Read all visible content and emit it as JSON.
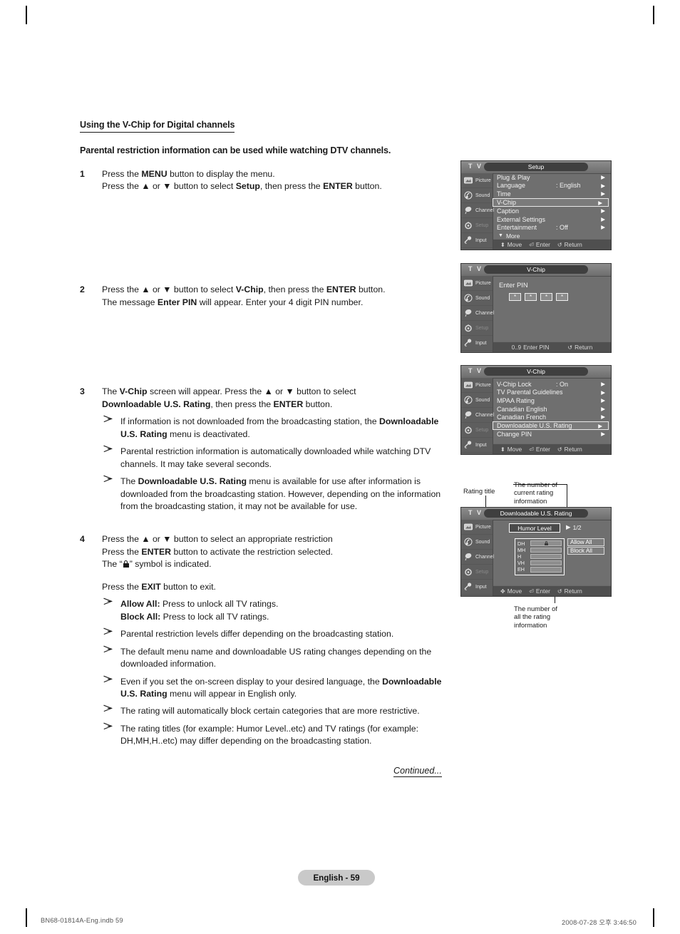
{
  "document": {
    "section_title": "Using the V-Chip for Digital channels",
    "lead": "Parental restriction information can be used while watching DTV channels.",
    "continued": "Continued...",
    "page_badge": "English - 59",
    "footer_left": "BN68-01814A-Eng.indb   59",
    "footer_right": "2008-07-28   오후 3:46:50"
  },
  "steps": {
    "s1": {
      "num": "1",
      "line1_a": "Press the ",
      "line1_b": "MENU",
      "line1_c": " button to display the menu.",
      "line2_a": "Press the ▲ or ▼ button to select ",
      "line2_b": "Setup",
      "line2_c": ", then press the ",
      "line2_d": "ENTER",
      "line2_e": " button."
    },
    "s2": {
      "num": "2",
      "line1_a": "Press the ▲ or ▼ button to select ",
      "line1_b": "V-Chip",
      "line1_c": ", then press the ",
      "line1_d": "ENTER",
      "line1_e": " button.",
      "line2_a": "The message ",
      "line2_b": "Enter PIN",
      "line2_c": " will appear. Enter your 4 digit PIN number."
    },
    "s3": {
      "num": "3",
      "line1_a": "The ",
      "line1_b": "V-Chip",
      "line1_c": " screen will appear. Press the ▲ or ▼ button to select",
      "line2_a": "Downloadable U.S. Rating",
      "line2_b": ", then press the ",
      "line2_c": "ENTER",
      "line2_d": " button.",
      "bullets": [
        {
          "a": "If information is not downloaded from the broadcasting station, the ",
          "b": "Downloadable U.S. Rating",
          "c": " menu is deactivated."
        },
        {
          "a": "Parental restriction information is automatically downloaded while watching DTV channels. It may take several seconds.",
          "b": "",
          "c": ""
        },
        {
          "a": "The ",
          "b": "Downloadable U.S. Rating",
          "c": " menu is available for use after information is downloaded from the broadcasting station. However, depending on the information from the broadcasting station, it may not be available for use."
        }
      ]
    },
    "s4": {
      "num": "4",
      "line1": "Press the ▲ or ▼ button to select an appropriate restriction",
      "line2_a": "Press the ",
      "line2_b": "ENTER",
      "line2_c": " button to activate the restriction selected.",
      "line3_a": "The “",
      "line3_b": "” symbol is indicated.",
      "exit_a": "Press the ",
      "exit_b": "EXIT",
      "exit_c": " button to exit.",
      "bullets": [
        {
          "a": "Allow All:",
          "b": " Press to unlock all TV ratings.",
          "c": "Block All:",
          "d": " Press to lock all TV ratings."
        },
        {
          "a": "Parental restriction levels differ depending on the broadcasting station."
        },
        {
          "a": "The default menu name and downloadable US rating changes depending on the downloaded information."
        },
        {
          "a": "Even if you set the on-screen display to your desired language, the ",
          "b": "Downloadable U.S. Rating",
          "c": " menu will appear in English only."
        },
        {
          "a": "The rating will automatically block certain categories that are more restrictive."
        },
        {
          "a": "The rating titles (for example: Humor Level..etc) and TV ratings (for example: DH,MH,H..etc) may differ depending on the broadcasting station."
        }
      ]
    }
  },
  "osd_common": {
    "tv_label": "T V",
    "sidebar": [
      {
        "label": "Picture",
        "icon": "picture-icon",
        "dim": false
      },
      {
        "label": "Sound",
        "icon": "sound-icon",
        "dim": false
      },
      {
        "label": "Channel",
        "icon": "channel-icon",
        "dim": false
      },
      {
        "label": "Setup",
        "icon": "setup-icon",
        "dim": true
      },
      {
        "label": "Input",
        "icon": "input-icon",
        "dim": false
      }
    ],
    "footer": {
      "move": "Move",
      "enter": "Enter",
      "return": "Return",
      "enter_pin": "Enter PIN",
      "pin_range": "0..9"
    },
    "arrow": "▶"
  },
  "osd1": {
    "title": "Setup",
    "rows": [
      {
        "name": "Plug & Play",
        "value": "",
        "selected": false
      },
      {
        "name": "Language",
        "value": ": English",
        "selected": false
      },
      {
        "name": "Time",
        "value": "",
        "selected": false
      },
      {
        "name": "V-Chip",
        "value": "",
        "selected": true
      },
      {
        "name": "Caption",
        "value": "",
        "selected": false
      },
      {
        "name": "External Settings",
        "value": "",
        "selected": false
      },
      {
        "name": "Entertainment",
        "value": ": Off",
        "selected": false
      }
    ],
    "more": "More"
  },
  "osd2": {
    "title": "V-Chip",
    "prompt": "Enter PIN",
    "pin_digits": [
      "*",
      "*",
      "*",
      "*"
    ]
  },
  "osd3": {
    "title": "V-Chip",
    "rows": [
      {
        "name": "V-Chip Lock",
        "value": ": On",
        "selected": false
      },
      {
        "name": "TV Parental Guidelines",
        "value": "",
        "selected": false
      },
      {
        "name": "MPAA Rating",
        "value": "",
        "selected": false
      },
      {
        "name": "Canadian English",
        "value": "",
        "selected": false
      },
      {
        "name": "Canadian French",
        "value": "",
        "selected": false
      },
      {
        "name": "Downloadable U.S. Rating",
        "value": "",
        "selected": true
      },
      {
        "name": "Change PIN",
        "value": "",
        "selected": false
      }
    ]
  },
  "osd4": {
    "title": "Downloadable U.S. Rating",
    "rating_title": "Humor Level",
    "rating_count": "1/2",
    "ratings": [
      {
        "code": "DH",
        "locked": true
      },
      {
        "code": "MH",
        "locked": false
      },
      {
        "code": "H",
        "locked": false
      },
      {
        "code": "VH",
        "locked": false
      },
      {
        "code": "EH",
        "locked": false
      }
    ],
    "allow_all": "Allow All",
    "block_all": "Block All"
  },
  "annotations": {
    "rating_title": "Rating title",
    "current_count": "The number of\ncurrent rating\ninformation",
    "all_count": "The number of\nall the rating\ninformation"
  }
}
